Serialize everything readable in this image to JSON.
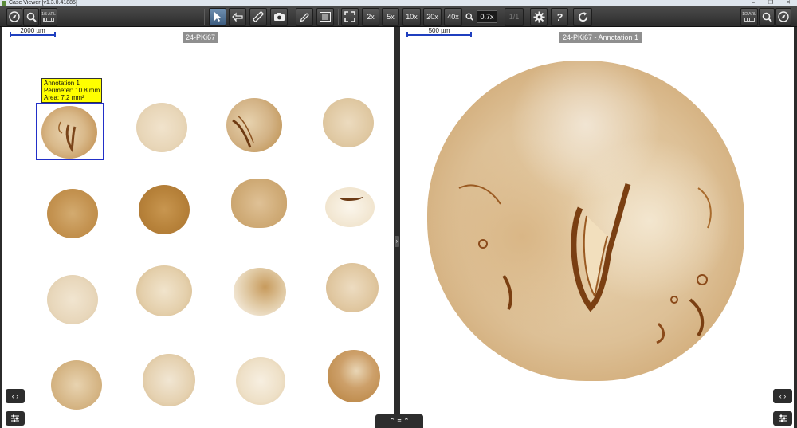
{
  "window": {
    "title": "Case Viewer [v1.3.0.41885]",
    "minimize": "–",
    "restore": "❐",
    "close": "✕"
  },
  "toolbar": {
    "left_mini_label": "1/5 ARL",
    "right_mini_label": "1/2 ARL",
    "zoom_2x": "2x",
    "zoom_5x": "5x",
    "zoom_10x": "10x",
    "zoom_20x": "20x",
    "zoom_40x": "40x",
    "zoom_value": "0.7x",
    "disabled_label": "1/1"
  },
  "left_viewer": {
    "scale_label": "2000 µm",
    "image_title": "24-PKi67",
    "annotation": {
      "name": "Annotation 1",
      "perimeter": "Perimeter: 10.8 mm",
      "area": "Area: 7.2 mm²"
    }
  },
  "right_viewer": {
    "scale_label": "500 µm",
    "image_title": "24-PKi67 - Annotation 1"
  },
  "icons": {
    "navigate": "compass-icon",
    "search": "magnifier-icon",
    "select": "cursor-icon",
    "pan": "hand-icon",
    "measure": "ruler-icon",
    "snapshot": "camera-icon",
    "annotate": "pen-icon",
    "list": "list-icon",
    "fit": "expand-icon",
    "settings": "gear-icon",
    "help": "question-icon",
    "sync": "refresh-icon"
  },
  "bottom": {
    "nav_arrows": "‹ ›",
    "panel_up": "⌃ ≡ ⌃"
  },
  "colors": {
    "toolbar": "#3a3a3a",
    "active_tool": "#4a6d92",
    "annotation_box": "#2230c8",
    "annotation_label_bg": "#ffff00",
    "scale_bar": "#1f3fbf",
    "stain_brown": "#a0692a"
  }
}
